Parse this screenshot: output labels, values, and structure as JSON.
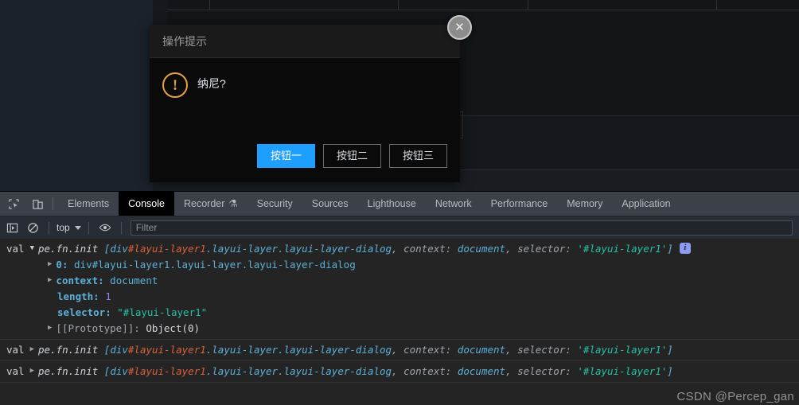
{
  "dialog": {
    "title": "操作提示",
    "icon": "warning-icon",
    "message": "纳尼?",
    "close_label": "✕",
    "buttons": [
      {
        "label": "按钮一",
        "primary": true
      },
      {
        "label": "按钮二",
        "primary": false
      },
      {
        "label": "按钮三",
        "primary": false
      }
    ]
  },
  "devtools": {
    "tabs": [
      {
        "label": "Elements",
        "active": false
      },
      {
        "label": "Console",
        "active": true
      },
      {
        "label": "Recorder",
        "active": false,
        "badge": "flask-icon"
      },
      {
        "label": "Security",
        "active": false
      },
      {
        "label": "Sources",
        "active": false
      },
      {
        "label": "Lighthouse",
        "active": false
      },
      {
        "label": "Network",
        "active": false
      },
      {
        "label": "Performance",
        "active": false
      },
      {
        "label": "Memory",
        "active": false
      },
      {
        "label": "Application",
        "active": false
      }
    ],
    "inspect_icon": "inspect-element-icon",
    "device_icon": "device-toolbar-icon",
    "filterbar": {
      "sidebar_icon": "console-sidebar-icon",
      "clear_icon": "clear-console-icon",
      "context": "top",
      "eye_icon": "live-expression-icon",
      "filter_placeholder": "Filter",
      "filter_value": ""
    }
  },
  "console": {
    "messages": [
      {
        "val_label": "val",
        "expanded": true,
        "head": {
          "fn": "pe.fn.init",
          "open_bracket": "[",
          "tag": "div",
          "id": "#layui-layer1",
          "classes": ".layui-layer.layui-layer-dialog",
          "sep1": ", ",
          "k_context": "context:",
          "v_context": "document",
          "sep2": ", ",
          "k_selector": "selector:",
          "v_selector": "'#layui-layer1'",
          "close_bracket": "]",
          "badge": "i"
        },
        "props": [
          {
            "indent": 1,
            "tri": true,
            "key": "0:",
            "value": "div#layui-layer1.layui-layer.layui-layer-dialog",
            "kind": "node"
          },
          {
            "indent": 1,
            "tri": true,
            "key": "context:",
            "value": "document",
            "kind": "node"
          },
          {
            "indent": 2,
            "tri": false,
            "key": "length:",
            "value": "1",
            "kind": "number"
          },
          {
            "indent": 2,
            "tri": false,
            "key": "selector:",
            "value": "\"#layui-layer1\"",
            "kind": "string"
          },
          {
            "indent": 1,
            "tri": true,
            "key": "[[Prototype]]:",
            "value": "Object(0)",
            "kind": "proto"
          }
        ]
      },
      {
        "val_label": "val",
        "expanded": false,
        "head": {
          "fn": "pe.fn.init",
          "open_bracket": "[",
          "tag": "div",
          "id": "#layui-layer1",
          "classes": ".layui-layer.layui-layer-dialog",
          "sep1": ", ",
          "k_context": "context:",
          "v_context": "document",
          "sep2": ", ",
          "k_selector": "selector:",
          "v_selector": "'#layui-layer1'",
          "close_bracket": "]",
          "badge": ""
        },
        "props": []
      },
      {
        "val_label": "val",
        "expanded": false,
        "head": {
          "fn": "pe.fn.init",
          "open_bracket": "[",
          "tag": "div",
          "id": "#layui-layer1",
          "classes": ".layui-layer.layui-layer-dialog",
          "sep1": ", ",
          "k_context": "context:",
          "v_context": "document",
          "sep2": ", ",
          "k_selector": "selector:",
          "v_selector": "'#layui-layer1'",
          "close_bracket": "]",
          "badge": ""
        },
        "props": []
      }
    ]
  },
  "watermark": "CSDN @Percep_gan",
  "colors": {
    "accent": "#1e9fff",
    "warning": "#e8a33d",
    "console_bg": "#242424",
    "devtools_bg": "#282c34",
    "tabbar_bg": "#3c4049"
  }
}
